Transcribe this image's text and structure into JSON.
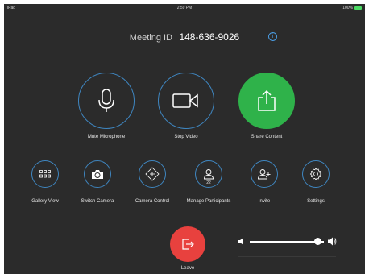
{
  "status_bar": {
    "device": "iPad",
    "time": "2:59 PM",
    "battery": "100%"
  },
  "meeting": {
    "id_label": "Meeting ID",
    "id_value": "148-636-9026"
  },
  "primary_controls": [
    {
      "label": "Mute Microphone",
      "icon": "microphone-icon"
    },
    {
      "label": "Stop Video",
      "icon": "video-camera-icon"
    },
    {
      "label": "Share Content",
      "icon": "share-icon"
    }
  ],
  "secondary_controls": [
    {
      "label": "Gallery View",
      "icon": "grid-icon"
    },
    {
      "label": "Switch Camera",
      "icon": "switch-camera-icon"
    },
    {
      "label": "Camera Control",
      "icon": "camera-control-icon"
    },
    {
      "label": "Manage Participants",
      "icon": "participants-icon",
      "badge": "22"
    },
    {
      "label": "Invite",
      "icon": "invite-icon"
    },
    {
      "label": "Settings",
      "icon": "gear-icon"
    }
  ],
  "leave": {
    "label": "Leave",
    "icon": "exit-icon"
  },
  "volume": {
    "level": 0.92
  },
  "colors": {
    "background": "#2b2b2b",
    "accent_ring": "#3f86c0",
    "share_green": "#2fb24a",
    "leave_red": "#e8413e"
  }
}
